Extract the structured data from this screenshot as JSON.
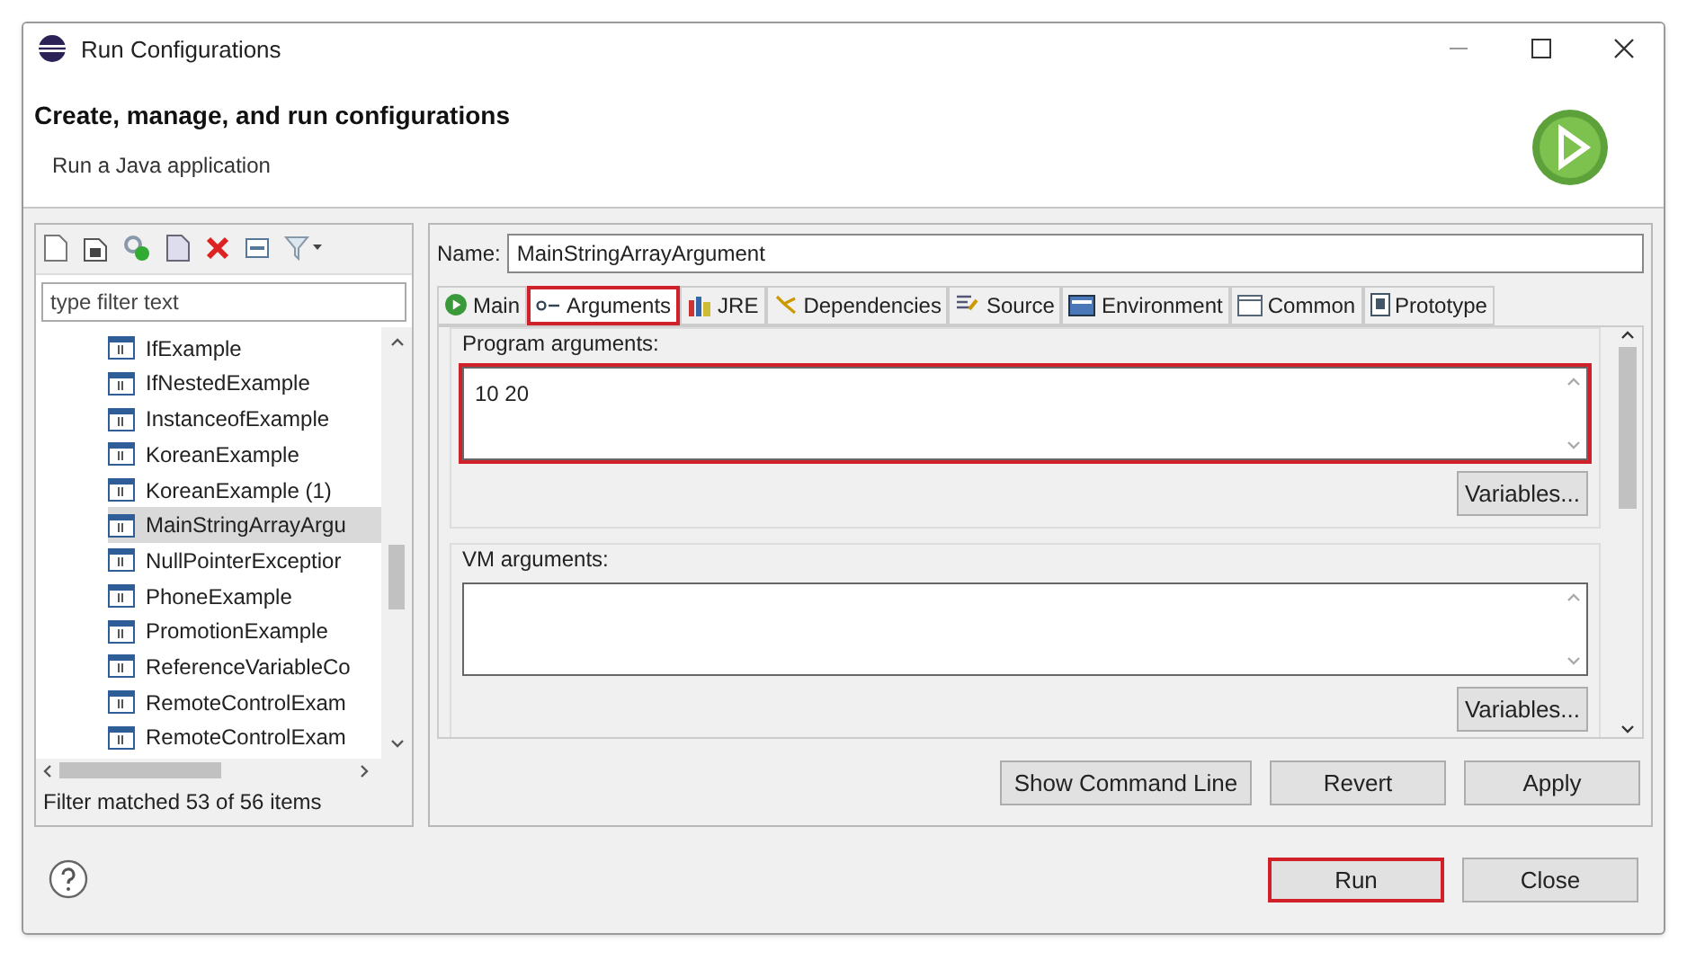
{
  "window": {
    "title": "Run Configurations"
  },
  "header": {
    "title": "Create, manage, and run configurations",
    "subtitle": "Run a Java application"
  },
  "filter": {
    "placeholder": "type filter text"
  },
  "configs": [
    {
      "label": "IfExample",
      "selected": false
    },
    {
      "label": "IfNestedExample",
      "selected": false
    },
    {
      "label": "InstanceofExample",
      "selected": false
    },
    {
      "label": "KoreanExample",
      "selected": false
    },
    {
      "label": "KoreanExample (1)",
      "selected": false
    },
    {
      "label": "MainStringArrayArgu",
      "selected": true
    },
    {
      "label": "NullPointerExceptior",
      "selected": false
    },
    {
      "label": "PhoneExample",
      "selected": false
    },
    {
      "label": "PromotionExample",
      "selected": false
    },
    {
      "label": "ReferenceVariableCo",
      "selected": false
    },
    {
      "label": "RemoteControlExam",
      "selected": false
    },
    {
      "label": "RemoteControlExam",
      "selected": false
    }
  ],
  "filter_status": "Filter matched 53 of 56 items",
  "name_field": {
    "label": "Name:",
    "value": "MainStringArrayArgument"
  },
  "tabs": [
    {
      "label": "Main",
      "kind": "main",
      "selected": false,
      "highlighted": false
    },
    {
      "label": "Arguments",
      "kind": "arguments",
      "selected": true,
      "highlighted": true
    },
    {
      "label": "JRE",
      "kind": "jre",
      "selected": false,
      "highlighted": false
    },
    {
      "label": "Dependencies",
      "kind": "dependencies",
      "selected": false,
      "highlighted": false
    },
    {
      "label": "Source",
      "kind": "source",
      "selected": false,
      "highlighted": false
    },
    {
      "label": "Environment",
      "kind": "environment",
      "selected": false,
      "highlighted": false
    },
    {
      "label": "Common",
      "kind": "common",
      "selected": false,
      "highlighted": false
    },
    {
      "label": "Prototype",
      "kind": "prototype",
      "selected": false,
      "highlighted": false
    }
  ],
  "sections": [
    {
      "label": "Program arguments:",
      "value": "10 20",
      "highlighted": true,
      "button": "Variables..."
    },
    {
      "label": "VM arguments:",
      "highlighted": false,
      "button": "Variables..."
    }
  ],
  "actions": [
    "Show Command Line",
    "Revert",
    "Apply"
  ],
  "footer": [
    {
      "label": "Run",
      "highlighted": true
    },
    {
      "label": "Close",
      "highlighted": false
    }
  ]
}
